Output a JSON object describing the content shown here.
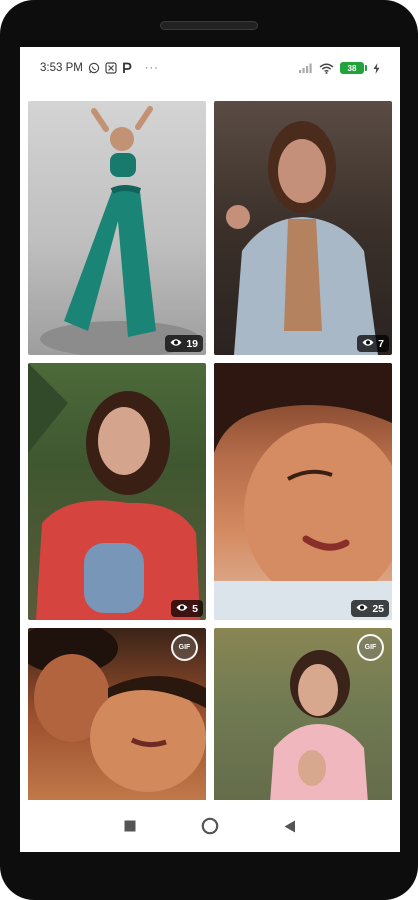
{
  "status_bar": {
    "time": "3:53 PM",
    "more": "···",
    "battery": "38",
    "icons": [
      "whatsapp-icon",
      "app-icon",
      "p-app-icon",
      "signal-icon",
      "wifi-icon",
      "battery-icon",
      "charging-icon"
    ]
  },
  "gallery": {
    "items": [
      {
        "views": "19",
        "type": "photo"
      },
      {
        "views": "7",
        "type": "photo"
      },
      {
        "views": "5",
        "type": "photo"
      },
      {
        "views": "25",
        "type": "photo"
      },
      {
        "badge": "GIF",
        "type": "gif"
      },
      {
        "badge": "GIF",
        "type": "gif"
      }
    ]
  },
  "nav": {
    "buttons": [
      "recents-button",
      "home-button",
      "back-button"
    ]
  },
  "colors": {
    "battery": "#22a33b",
    "badge_bg": "#000000",
    "screen_bg": "#ffffff"
  }
}
